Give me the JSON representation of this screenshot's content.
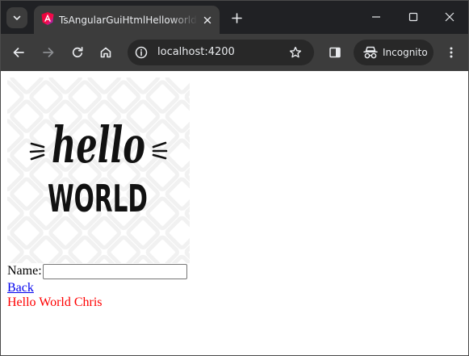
{
  "browser": {
    "tab_title": "TsAngularGuiHtmlHelloworldSimple",
    "url": "localhost:4200",
    "profile_label": "Incognito"
  },
  "page": {
    "hero_image": {
      "line1": "hello",
      "line2": "WORLD"
    },
    "form": {
      "name_label": "Name:",
      "name_value": ""
    },
    "back_link": "Back",
    "greeting": "Hello World Chris"
  },
  "colors": {
    "frame": "#202124",
    "toolbar": "#3c3c3c",
    "omnibox": "#282828",
    "link": "#0000ee",
    "greeting": "#ff0000"
  },
  "icons": {
    "tab_search": "chevron-down-icon",
    "favicon": "angular-icon",
    "tab_close": "close-icon",
    "new_tab": "plus-icon",
    "minimize": "minimize-icon",
    "maximize": "maximize-icon",
    "close_window": "close-icon",
    "back": "arrow-left-icon",
    "forward": "arrow-right-icon",
    "reload": "reload-icon",
    "home": "home-icon",
    "site_info": "info-icon",
    "bookmark": "star-icon",
    "side_panel": "side-panel-icon",
    "incognito": "incognito-icon",
    "menu": "kebab-menu-icon"
  }
}
